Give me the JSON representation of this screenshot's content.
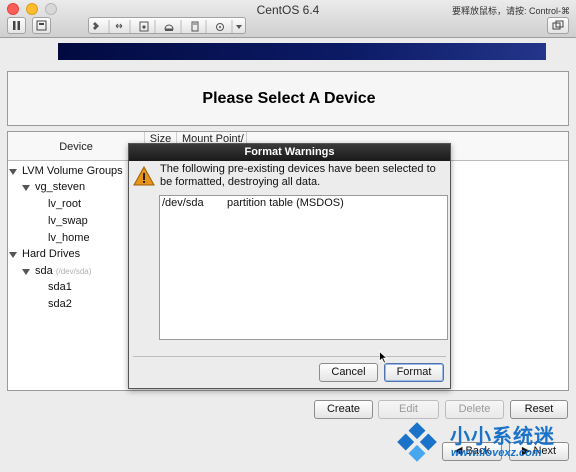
{
  "window": {
    "title": "CentOS 6.4",
    "release_hint": "要释放鼠标，请按: Control-⌘"
  },
  "installer": {
    "page_title": "Please Select A Device",
    "columns": {
      "device": "Device",
      "size": "Size",
      "mount_point": "Mount Point/"
    },
    "tree": {
      "lvm_groups": "LVM Volume Groups",
      "vg": "vg_steven",
      "lv_root": "lv_root",
      "lv_swap": "lv_swap",
      "lv_home": "lv_home",
      "hard_drives": "Hard Drives",
      "sda": "sda",
      "sda_path": "(/dev/sda)",
      "sda1": "sda1",
      "sda2": "sda2"
    },
    "buttons": {
      "create": "Create",
      "edit": "Edit",
      "delete": "Delete",
      "reset": "Reset",
      "back": "Back",
      "next": "Next"
    }
  },
  "dialog": {
    "title": "Format Warnings",
    "message": "The following pre-existing devices have been selected to be formatted, destroying all data.",
    "devices": [
      {
        "device": "/dev/sda",
        "description": "partition table (MSDOS)"
      }
    ],
    "cancel_label": "Cancel",
    "format_label": "Format"
  },
  "watermark": {
    "text": "小小系统迷",
    "url": "www.ilovexz.com"
  },
  "colors": {
    "banner": "#0c1b66",
    "warning_icon": "#e8941a",
    "watermark": "#1a73c9"
  }
}
